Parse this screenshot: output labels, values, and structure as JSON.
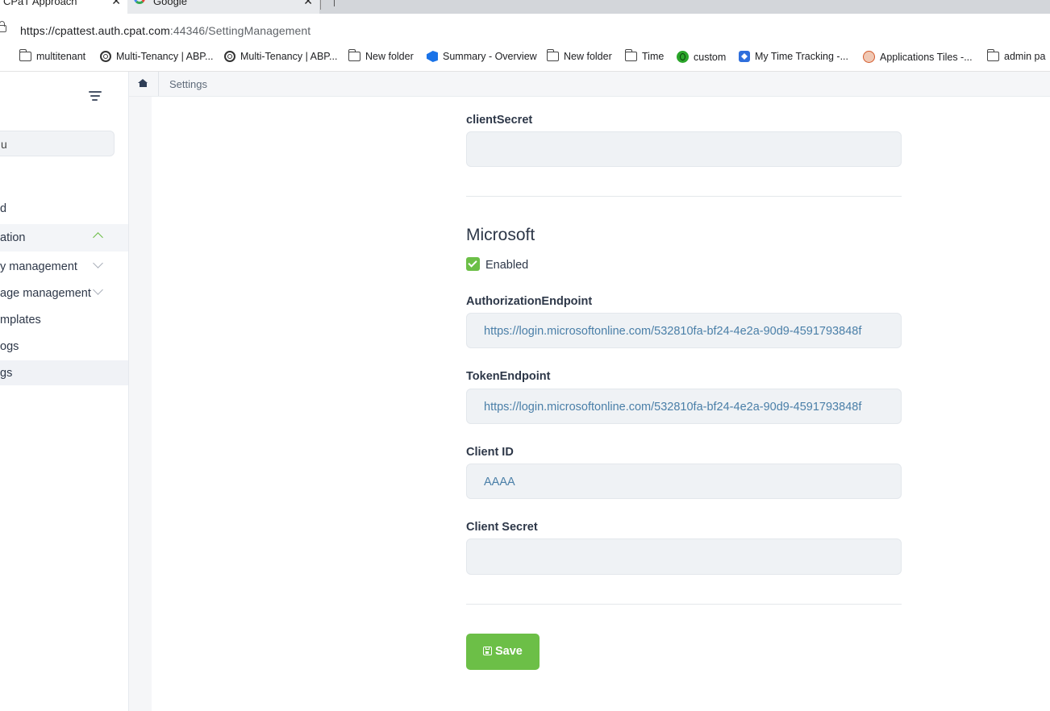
{
  "browser": {
    "tabs": [
      {
        "title": "CPaT Approach",
        "active": true
      },
      {
        "title": "Google",
        "active": false
      }
    ],
    "url": {
      "host": "https://cpattest.auth.cpat.com",
      "rest": ":44346/SettingManagement"
    },
    "bookmarks": [
      {
        "label": "multitenant",
        "icon": "folder-icon"
      },
      {
        "label": "Multi-Tenancy | ABP...",
        "icon": "abp-spiral-icon"
      },
      {
        "label": "Multi-Tenancy | ABP...",
        "icon": "abp-spiral-icon"
      },
      {
        "label": "New folder",
        "icon": "folder-icon"
      },
      {
        "label": "Summary - Overview",
        "icon": "azure-devops-icon"
      },
      {
        "label": "New folder",
        "icon": "folder-icon"
      },
      {
        "label": "Time",
        "icon": "folder-icon"
      },
      {
        "label": "custom",
        "icon": "green-globe-icon"
      },
      {
        "label": "My Time Tracking -...",
        "icon": "jira-icon"
      },
      {
        "label": "Applications Tiles -...",
        "icon": "avatar-icon"
      },
      {
        "label": "admin pa",
        "icon": "folder-icon"
      }
    ]
  },
  "sidebar": {
    "search_text": "u",
    "items": [
      {
        "label": "d"
      },
      {
        "label": "ation"
      },
      {
        "label": "y management"
      },
      {
        "label": "age management"
      },
      {
        "label": "mplates"
      },
      {
        "label": "ogs"
      },
      {
        "label": "gs"
      }
    ]
  },
  "breadcrumb": {
    "current": "Settings"
  },
  "form": {
    "client_secret_top": {
      "label": "clientSecret",
      "value": ""
    },
    "section_title": "Microsoft",
    "enabled_label": "Enabled",
    "enabled": true,
    "authorization_endpoint": {
      "label": "AuthorizationEndpoint",
      "value": "https://login.microsoftonline.com/532810fa-bf24-4e2a-90d9-4591793848f"
    },
    "token_endpoint": {
      "label": "TokenEndpoint",
      "value": "https://login.microsoftonline.com/532810fa-bf24-4e2a-90d9-4591793848f"
    },
    "client_id": {
      "label": "Client ID",
      "value": "AAAA"
    },
    "client_secret": {
      "label": "Client Secret",
      "value": ""
    },
    "save_label": "Save"
  },
  "colors": {
    "accent": "#6cbf47",
    "input_bg": "#eff2f5",
    "input_text": "#4a7fa8"
  }
}
